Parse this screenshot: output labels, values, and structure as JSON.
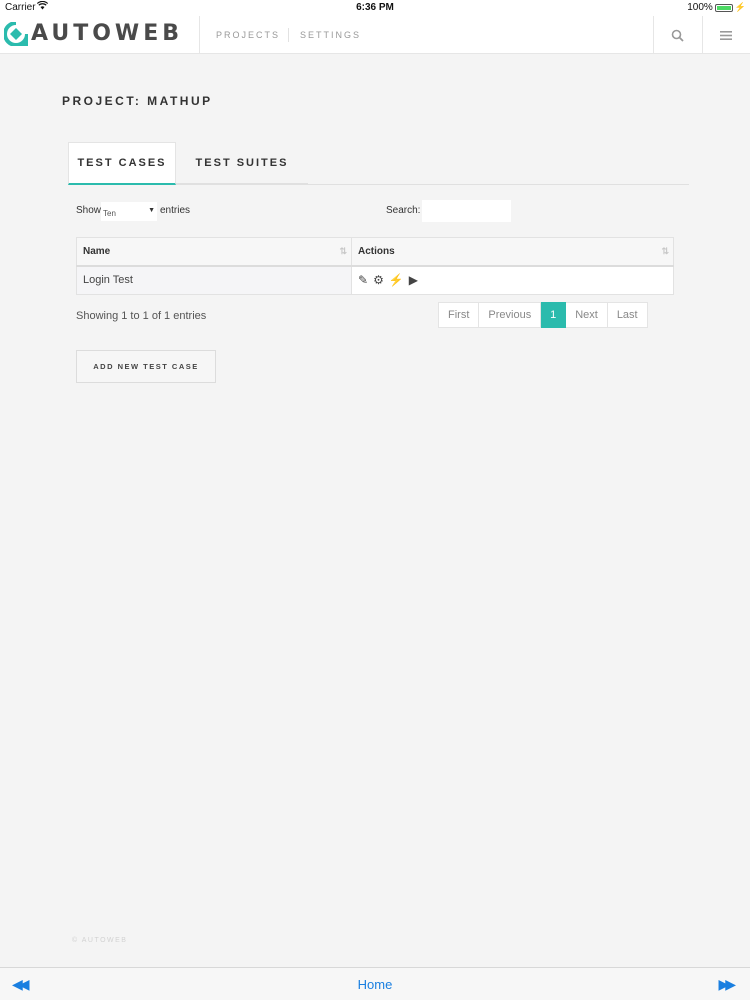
{
  "status_bar": {
    "carrier": "Carrier",
    "time": "6:36 PM",
    "battery": "100%"
  },
  "header": {
    "logo_text": "AUTOWEB",
    "nav": [
      "PROJECTS",
      "SETTINGS"
    ],
    "icons": [
      "search-icon",
      "menu-icon"
    ]
  },
  "page": {
    "title": "PROJECT: MATHUP",
    "tabs": [
      {
        "label": "TEST CASES",
        "active": true
      },
      {
        "label": "TEST SUITES",
        "active": false
      }
    ]
  },
  "table_controls": {
    "show_label": "Show",
    "page_size_value": "Ten",
    "entries_label": "entries",
    "search_label": "Search:",
    "search_value": ""
  },
  "table": {
    "columns": [
      "Name",
      "Actions"
    ],
    "rows": [
      {
        "name": "Login Test",
        "actions": [
          "edit-icon",
          "settings-icon",
          "run-icon",
          "play-icon"
        ]
      }
    ]
  },
  "summary": "Showing 1 to 1 of 1 entries",
  "pagination": {
    "buttons": [
      "First",
      "Previous",
      "1",
      "Next",
      "Last"
    ],
    "current": "1"
  },
  "add_button_label": "ADD NEW TEST CASE",
  "footer": "© AUTOWEB",
  "bottom_bar": {
    "home_label": "Home",
    "icons": [
      "rewind-icon",
      "fast-forward-icon"
    ]
  },
  "colors": {
    "accent": "#2bbbad",
    "link_blue": "#1a7fe0"
  }
}
